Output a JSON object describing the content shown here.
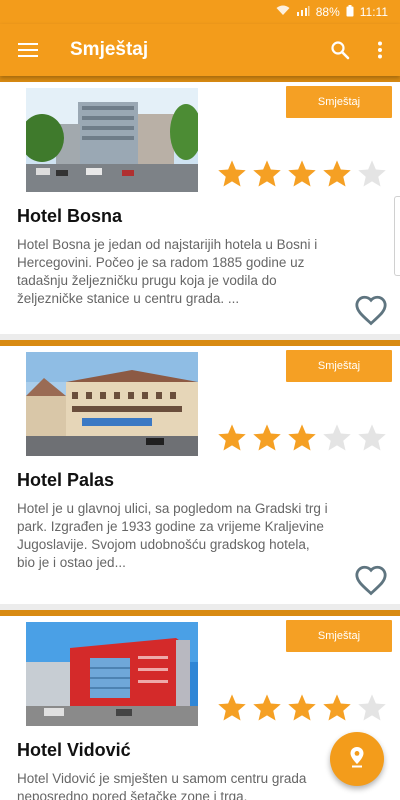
{
  "status_bar": {
    "battery": "88%",
    "time": "11:11"
  },
  "app_bar": {
    "title": "Smještaj",
    "menu_icon": "hamburger-icon",
    "search_icon": "search-icon",
    "more_icon": "more-vert-icon"
  },
  "colors": {
    "primary": "#f39c1b",
    "accent": "#f5a024",
    "star_on": "#f5a024",
    "star_off": "#e4e4e4",
    "heart": "#5f7580"
  },
  "hotels": [
    {
      "category_label": "Smještaj",
      "name": "Hotel Bosna",
      "rating": 4,
      "max_rating": 5,
      "description": "Hotel Bosna je jedan od najstarijih hotela u Bosni i Hercegovini. Počeo je sa radom 1885 godine uz tadašnju željezničku prugu koja je vodila do željezničke stanice u centru grada. ..."
    },
    {
      "category_label": "Smještaj",
      "name": "Hotel Palas",
      "rating": 3,
      "max_rating": 5,
      "description": "Hotel je u glavnoj ulici, sa pogledom na Gradski trg i park. Izgrađen je 1933 godine za vrijeme Kraljevine Jugoslavije. Svojom udobnošću gradskog hotela, bio je i ostao jed..."
    },
    {
      "category_label": "Smještaj",
      "name": "Hotel Vidović",
      "rating": 4,
      "max_rating": 5,
      "description": "Hotel Vidović je smješten u samom centru grada neposredno pored šetačke zone i trga."
    }
  ],
  "fab": {
    "icon": "map-pin-icon"
  }
}
